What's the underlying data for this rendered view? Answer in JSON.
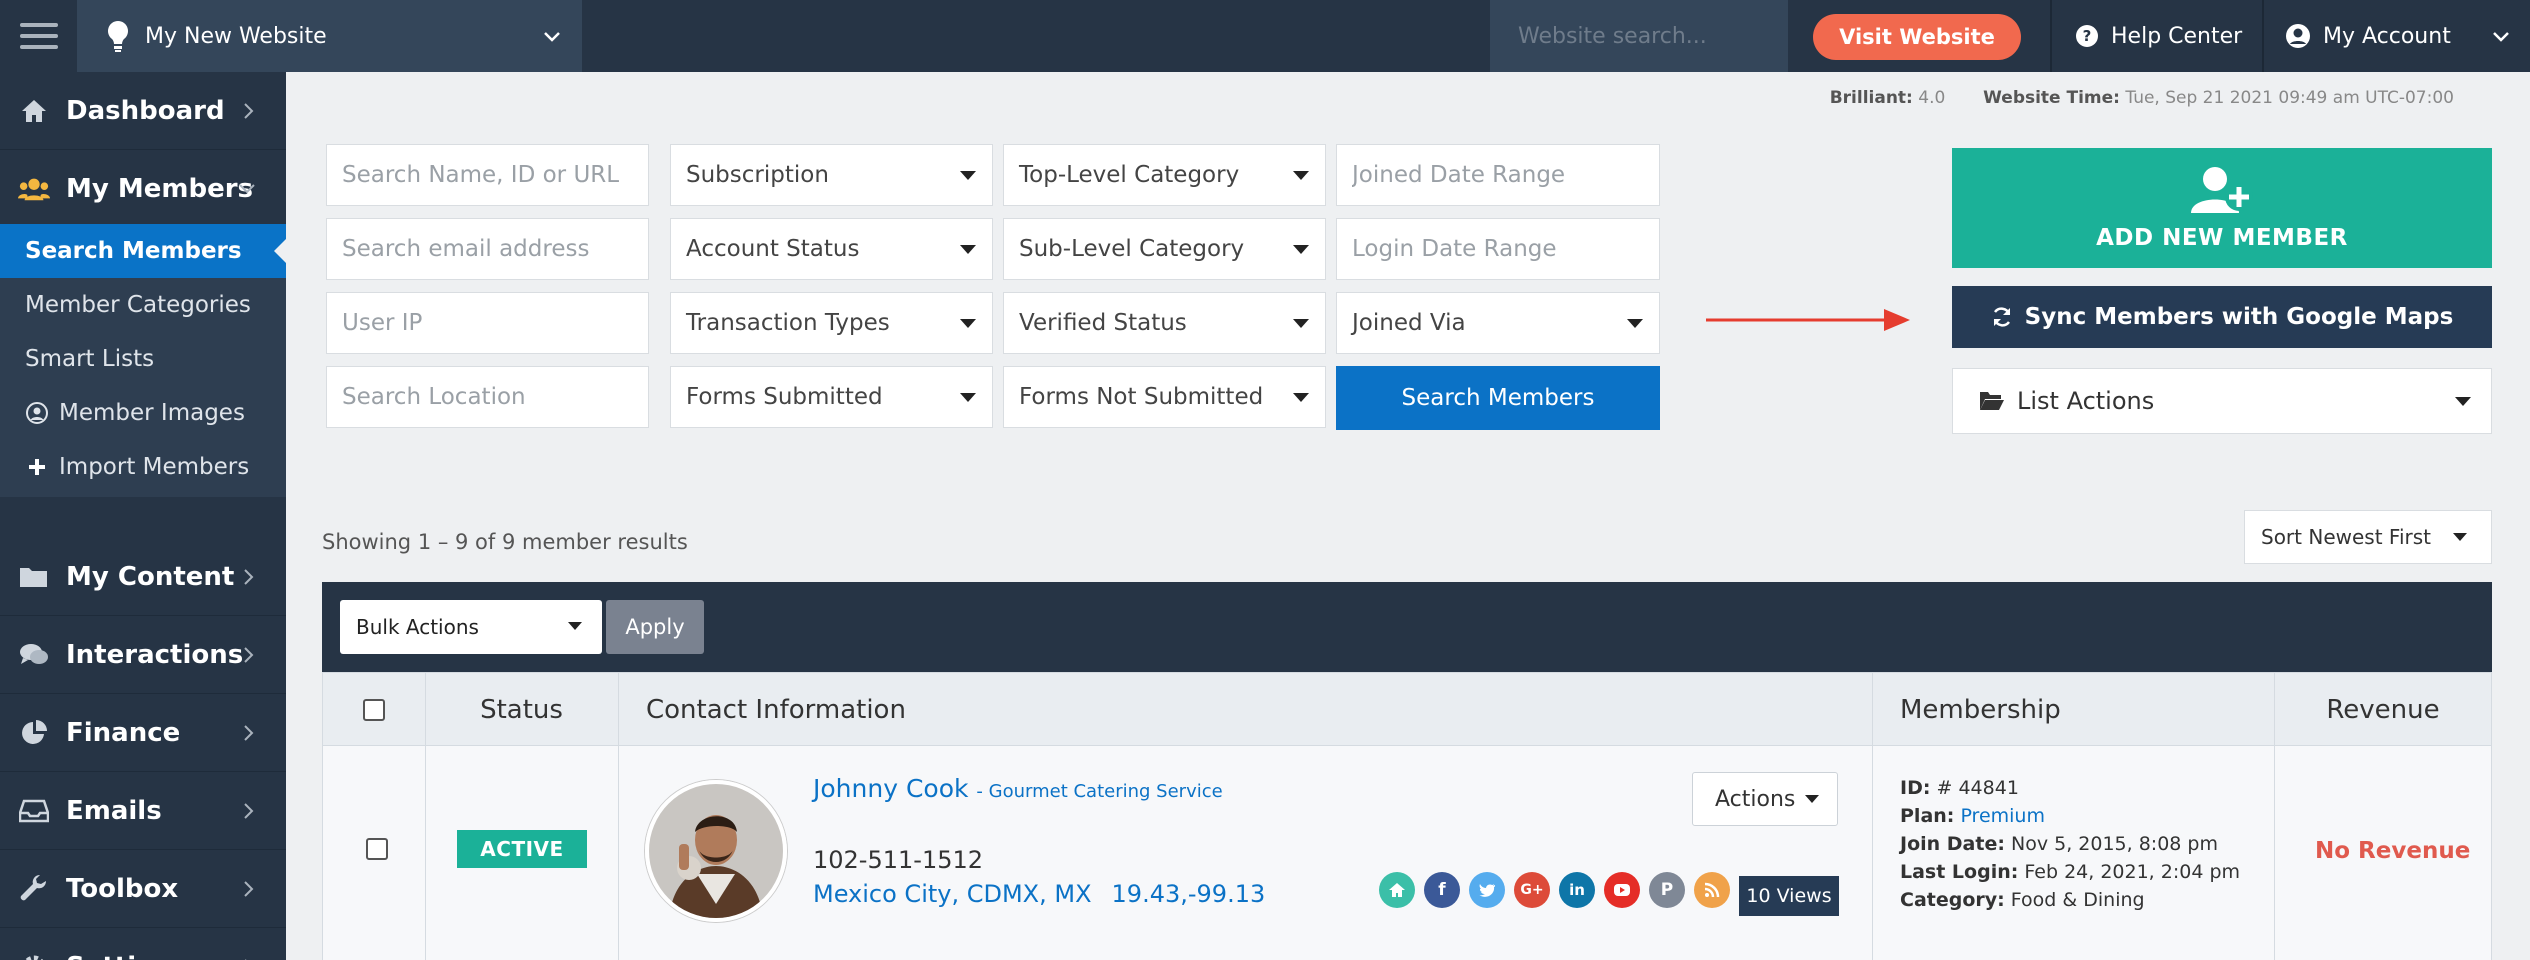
{
  "topbar": {
    "site_name": "My New Website",
    "search_placeholder": "Website search...",
    "visit_label": "Visit Website",
    "help_label": "Help Center",
    "account_label": "My Account"
  },
  "sidebar": {
    "items": [
      {
        "label": "Dashboard",
        "icon": "home-icon"
      },
      {
        "label": "My Members",
        "icon": "users-icon"
      },
      {
        "label": "My Content",
        "icon": "folder-icon"
      },
      {
        "label": "Interactions",
        "icon": "comments-icon"
      },
      {
        "label": "Finance",
        "icon": "pie-chart-icon"
      },
      {
        "label": "Emails",
        "icon": "inbox-icon"
      },
      {
        "label": "Toolbox",
        "icon": "wrench-icon"
      },
      {
        "label": "Settings",
        "icon": "gear-icon"
      }
    ],
    "subitems": [
      {
        "label": "Search Members"
      },
      {
        "label": "Member Categories"
      },
      {
        "label": "Smart Lists"
      },
      {
        "label": "Member Images",
        "icon": "user-circle-icon"
      },
      {
        "label": "Import Members",
        "icon": "plus-icon"
      }
    ]
  },
  "meta": {
    "brilliant_label": "Brilliant:",
    "brilliant_value": "4.0",
    "time_label": "Website Time:",
    "time_value": "Tue, Sep 21 2021 09:49 am UTC-07:00"
  },
  "filters": {
    "search_name_placeholder": "Search Name, ID or URL",
    "search_email_placeholder": "Search email address",
    "user_ip_placeholder": "User IP",
    "search_location_placeholder": "Search Location",
    "subscription": "Subscription",
    "account_status": "Account Status",
    "transaction_types": "Transaction Types",
    "forms_submitted": "Forms Submitted",
    "top_level_category": "Top-Level Category",
    "sub_level_category": "Sub-Level Category",
    "verified_status": "Verified Status",
    "forms_not_submitted": "Forms Not Submitted",
    "joined_date_placeholder": "Joined Date Range",
    "login_date_placeholder": "Login Date Range",
    "joined_via": "Joined Via",
    "search_button": "Search Members"
  },
  "actions": {
    "add_member": "ADD NEW MEMBER",
    "sync": "Sync Members with Google Maps",
    "list_actions": "List Actions"
  },
  "results": {
    "showing": "Showing 1 – 9 of 9 member results",
    "sort": "Sort Newest First"
  },
  "table": {
    "bulk_actions": "Bulk Actions",
    "apply": "Apply",
    "headers": {
      "status": "Status",
      "contact": "Contact Information",
      "membership": "Membership",
      "revenue": "Revenue"
    },
    "rows": [
      {
        "status": "ACTIVE",
        "name": "Johnny Cook",
        "company": "- Gourmet Catering Service",
        "phone": "102-511-1512",
        "location": "Mexico City, CDMX, MX",
        "coords": "19.43,-99.13",
        "actions_label": "Actions",
        "views": "10 Views",
        "id_label": "ID:",
        "id_value": "# 44841",
        "plan_label": "Plan:",
        "plan_value": "Premium",
        "join_label": "Join Date:",
        "join_value": "Nov 5, 2015, 8:08 pm",
        "login_label": "Last Login:",
        "login_value": "Feb 24, 2021, 2:04 pm",
        "category_label": "Category:",
        "category_value": "Food & Dining",
        "revenue": "No Revenue"
      }
    ]
  },
  "social_icons": [
    {
      "name": "home-icon",
      "color": "#3bbfa8"
    },
    {
      "name": "facebook-icon",
      "color": "#3b5998"
    },
    {
      "name": "twitter-icon",
      "color": "#55acee"
    },
    {
      "name": "google-plus-icon",
      "color": "#dd4b39"
    },
    {
      "name": "linkedin-icon",
      "color": "#0e76a8"
    },
    {
      "name": "youtube-icon",
      "color": "#e52d27"
    },
    {
      "name": "pinterest-icon",
      "color": "#7f8896"
    },
    {
      "name": "rss-icon",
      "color": "#f0a24a"
    }
  ],
  "colors": {
    "sidebar": "#263445",
    "active": "#0a73c7",
    "accent_green": "#1bb198",
    "visit": "#f1694e",
    "revenue_red": "#e05a4e"
  }
}
